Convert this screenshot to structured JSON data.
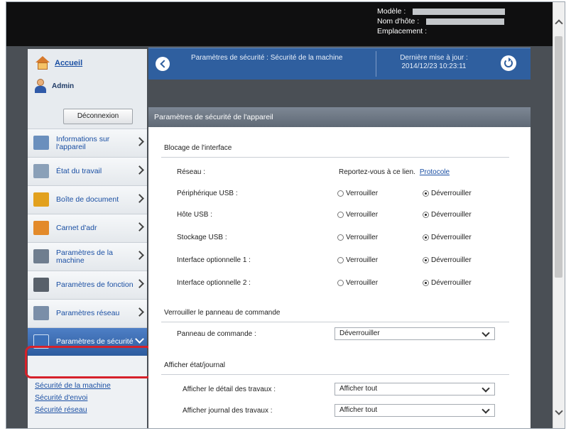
{
  "header": {
    "model_label": "Modèle :",
    "host_label": "Nom d'hôte :",
    "location_label": "Emplacement :"
  },
  "sidebar": {
    "home_label": "Accueil",
    "user_label": "Admin",
    "logout_label": "Déconnexion",
    "items": [
      {
        "label": "Informations sur l'appareil",
        "icon": "device-info-icon",
        "color": "#6a8fbd"
      },
      {
        "label": "État du travail",
        "icon": "job-status-icon",
        "color": "#8aa0b8"
      },
      {
        "label": "Boîte de document",
        "icon": "document-box-icon",
        "color": "#e2a11e"
      },
      {
        "label": "Carnet d'adr",
        "icon": "address-book-icon",
        "color": "#e38a2a"
      },
      {
        "label": "Paramètres de la machine",
        "icon": "machine-settings-icon",
        "color": "#6f7e8f"
      },
      {
        "label": "Paramètres de fonction",
        "icon": "function-settings-icon",
        "color": "#58606a"
      },
      {
        "label": "Paramètres réseau",
        "icon": "network-settings-icon",
        "color": "#7a8ea8"
      },
      {
        "label": "Paramètres de sécurité",
        "icon": "security-settings-icon",
        "color": "#3b6fb8"
      }
    ],
    "sub_items": [
      "Sécurité de la machine",
      "Sécurité d'envoi",
      "Sécurité réseau"
    ]
  },
  "topbar": {
    "breadcrumb": "Paramètres de sécurité : Sécurité de la machine",
    "last_update_label": "Dernière mise à jour :",
    "last_update_value": "2014/12/23 10:23:11"
  },
  "panel": {
    "title": "Paramètres de sécurité de l'appareil",
    "interface_section": "Blocage de l'interface",
    "network_label": "Réseau :",
    "network_note": "Reportez-vous à ce lien.",
    "protocol_link": "Protocole",
    "lock_label": "Verrouiller",
    "unlock_label": "Déverrouiller",
    "rows": [
      {
        "label": "Périphérique USB :"
      },
      {
        "label": "Hôte USB :"
      },
      {
        "label": "Stockage USB :"
      },
      {
        "label": "Interface optionnelle 1 :"
      },
      {
        "label": "Interface optionnelle 2 :"
      }
    ],
    "panel_section": "Verrouiller le panneau de commande",
    "panel_label": "Panneau de commande :",
    "panel_value": "Déverrouiller",
    "status_section": "Afficher état/journal",
    "detail_label": "Afficher le détail des travaux :",
    "detail_value": "Afficher tout",
    "journal_label": "Afficher journal des travaux :",
    "journal_value": "Afficher tout"
  }
}
